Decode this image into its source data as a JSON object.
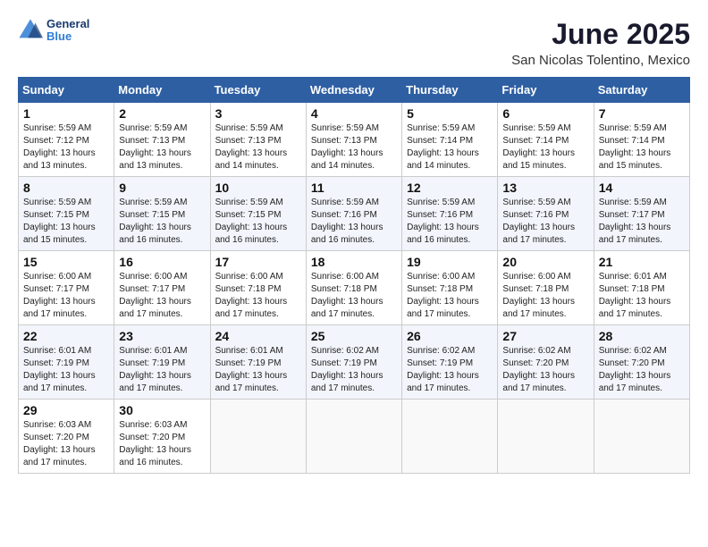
{
  "header": {
    "logo_line1": "General",
    "logo_line2": "Blue",
    "month": "June 2025",
    "location": "San Nicolas Tolentino, Mexico"
  },
  "weekdays": [
    "Sunday",
    "Monday",
    "Tuesday",
    "Wednesday",
    "Thursday",
    "Friday",
    "Saturday"
  ],
  "weeks": [
    [
      {
        "day": 1,
        "sunrise": "5:59 AM",
        "sunset": "7:12 PM",
        "daylight": "13 hours and 13 minutes."
      },
      {
        "day": 2,
        "sunrise": "5:59 AM",
        "sunset": "7:13 PM",
        "daylight": "13 hours and 13 minutes."
      },
      {
        "day": 3,
        "sunrise": "5:59 AM",
        "sunset": "7:13 PM",
        "daylight": "13 hours and 14 minutes."
      },
      {
        "day": 4,
        "sunrise": "5:59 AM",
        "sunset": "7:13 PM",
        "daylight": "13 hours and 14 minutes."
      },
      {
        "day": 5,
        "sunrise": "5:59 AM",
        "sunset": "7:14 PM",
        "daylight": "13 hours and 14 minutes."
      },
      {
        "day": 6,
        "sunrise": "5:59 AM",
        "sunset": "7:14 PM",
        "daylight": "13 hours and 15 minutes."
      },
      {
        "day": 7,
        "sunrise": "5:59 AM",
        "sunset": "7:14 PM",
        "daylight": "13 hours and 15 minutes."
      }
    ],
    [
      {
        "day": 8,
        "sunrise": "5:59 AM",
        "sunset": "7:15 PM",
        "daylight": "13 hours and 15 minutes."
      },
      {
        "day": 9,
        "sunrise": "5:59 AM",
        "sunset": "7:15 PM",
        "daylight": "13 hours and 16 minutes."
      },
      {
        "day": 10,
        "sunrise": "5:59 AM",
        "sunset": "7:15 PM",
        "daylight": "13 hours and 16 minutes."
      },
      {
        "day": 11,
        "sunrise": "5:59 AM",
        "sunset": "7:16 PM",
        "daylight": "13 hours and 16 minutes."
      },
      {
        "day": 12,
        "sunrise": "5:59 AM",
        "sunset": "7:16 PM",
        "daylight": "13 hours and 16 minutes."
      },
      {
        "day": 13,
        "sunrise": "5:59 AM",
        "sunset": "7:16 PM",
        "daylight": "13 hours and 17 minutes."
      },
      {
        "day": 14,
        "sunrise": "5:59 AM",
        "sunset": "7:17 PM",
        "daylight": "13 hours and 17 minutes."
      }
    ],
    [
      {
        "day": 15,
        "sunrise": "6:00 AM",
        "sunset": "7:17 PM",
        "daylight": "13 hours and 17 minutes."
      },
      {
        "day": 16,
        "sunrise": "6:00 AM",
        "sunset": "7:17 PM",
        "daylight": "13 hours and 17 minutes."
      },
      {
        "day": 17,
        "sunrise": "6:00 AM",
        "sunset": "7:18 PM",
        "daylight": "13 hours and 17 minutes."
      },
      {
        "day": 18,
        "sunrise": "6:00 AM",
        "sunset": "7:18 PM",
        "daylight": "13 hours and 17 minutes."
      },
      {
        "day": 19,
        "sunrise": "6:00 AM",
        "sunset": "7:18 PM",
        "daylight": "13 hours and 17 minutes."
      },
      {
        "day": 20,
        "sunrise": "6:00 AM",
        "sunset": "7:18 PM",
        "daylight": "13 hours and 17 minutes."
      },
      {
        "day": 21,
        "sunrise": "6:01 AM",
        "sunset": "7:18 PM",
        "daylight": "13 hours and 17 minutes."
      }
    ],
    [
      {
        "day": 22,
        "sunrise": "6:01 AM",
        "sunset": "7:19 PM",
        "daylight": "13 hours and 17 minutes."
      },
      {
        "day": 23,
        "sunrise": "6:01 AM",
        "sunset": "7:19 PM",
        "daylight": "13 hours and 17 minutes."
      },
      {
        "day": 24,
        "sunrise": "6:01 AM",
        "sunset": "7:19 PM",
        "daylight": "13 hours and 17 minutes."
      },
      {
        "day": 25,
        "sunrise": "6:02 AM",
        "sunset": "7:19 PM",
        "daylight": "13 hours and 17 minutes."
      },
      {
        "day": 26,
        "sunrise": "6:02 AM",
        "sunset": "7:19 PM",
        "daylight": "13 hours and 17 minutes."
      },
      {
        "day": 27,
        "sunrise": "6:02 AM",
        "sunset": "7:20 PM",
        "daylight": "13 hours and 17 minutes."
      },
      {
        "day": 28,
        "sunrise": "6:02 AM",
        "sunset": "7:20 PM",
        "daylight": "13 hours and 17 minutes."
      }
    ],
    [
      {
        "day": 29,
        "sunrise": "6:03 AM",
        "sunset": "7:20 PM",
        "daylight": "13 hours and 17 minutes."
      },
      {
        "day": 30,
        "sunrise": "6:03 AM",
        "sunset": "7:20 PM",
        "daylight": "13 hours and 16 minutes."
      },
      null,
      null,
      null,
      null,
      null
    ]
  ]
}
